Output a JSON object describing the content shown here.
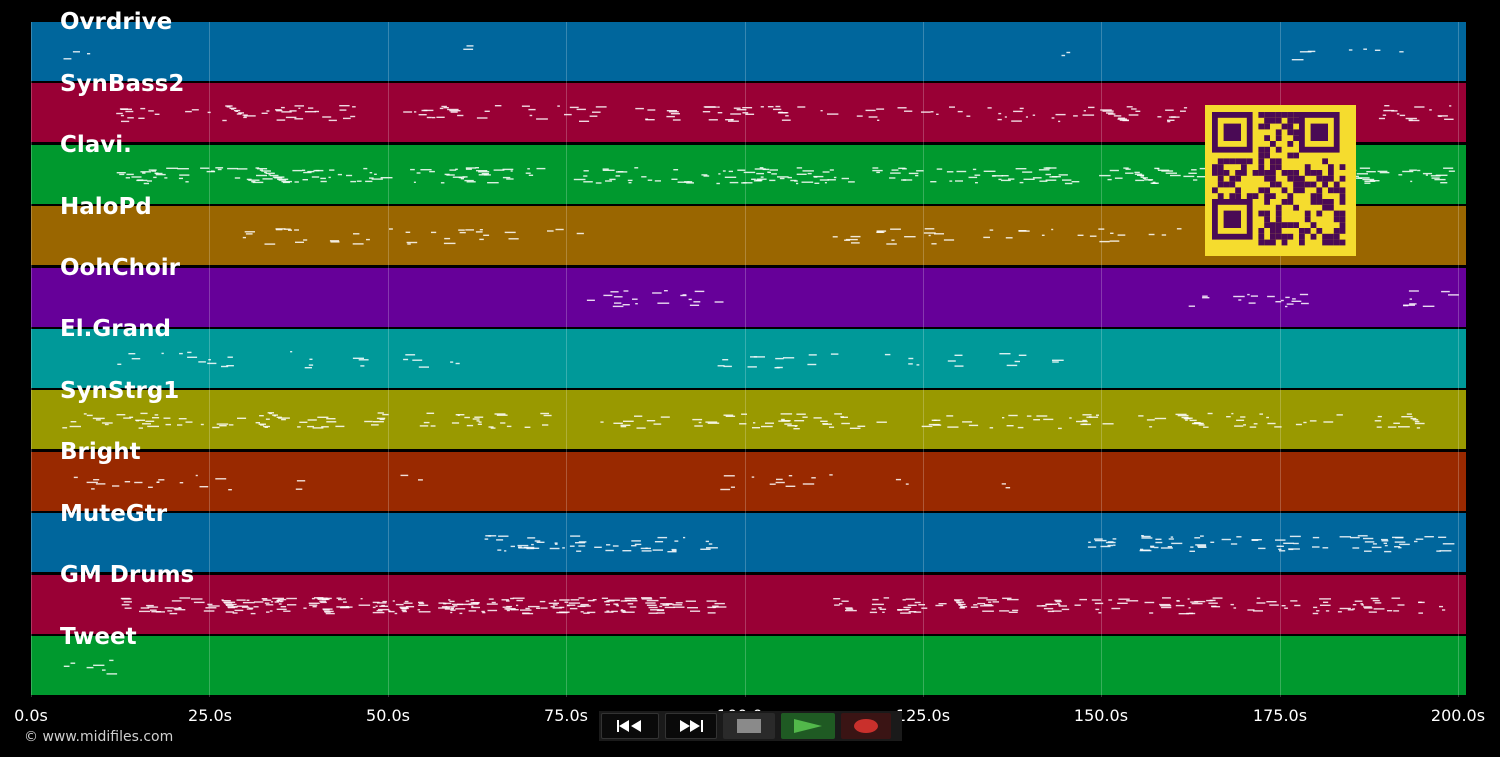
{
  "tracks": [
    {
      "name": "Ovrdrive",
      "color": "#00669c"
    },
    {
      "name": "SynBass2",
      "color": "#990035"
    },
    {
      "name": "Clavi.",
      "color": "#00992e"
    },
    {
      "name": "HaloPd",
      "color": "#9a6600"
    },
    {
      "name": "OohChoir",
      "color": "#660099"
    },
    {
      "name": "El.Grand",
      "color": "#009999"
    },
    {
      "name": "SynStrg1",
      "color": "#999900"
    },
    {
      "name": "Bright",
      "color": "#992900"
    },
    {
      "name": "MuteGtr",
      "color": "#00669c"
    },
    {
      "name": "GM Drums",
      "color": "#990035"
    },
    {
      "name": "Tweet",
      "color": "#00992e"
    }
  ],
  "timeline": {
    "ticks": [
      "0.0s",
      "25.0s",
      "50.0s",
      "75.0s",
      "100.0s",
      "125.0s",
      "150.0s",
      "175.0s",
      "200.0s"
    ]
  },
  "transport": {
    "rewind_icon": "rewind-icon",
    "fast_forward_icon": "fast-forward-icon",
    "stop_icon": "stop-icon",
    "play_icon": "play-icon",
    "record_icon": "record-icon"
  },
  "qr_code": {
    "icon": "qr-code-icon",
    "color": "#f5dc2e",
    "module_color": "#4a0a55"
  },
  "copyright": "© www.midifiles.com"
}
